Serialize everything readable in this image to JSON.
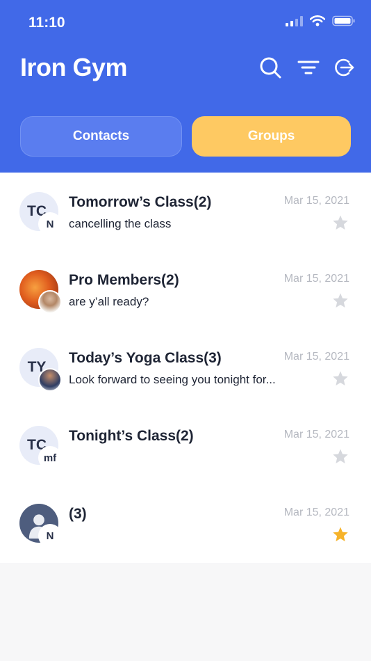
{
  "status_bar": {
    "time": "11:10"
  },
  "header": {
    "title": "Iron Gym",
    "icons": [
      "search-icon",
      "filter-icon",
      "logout-icon"
    ]
  },
  "tabs": [
    {
      "label": "Contacts",
      "active": false
    },
    {
      "label": "Groups",
      "active": true
    }
  ],
  "groups": [
    {
      "title": "Tomorrow’s Class(2)",
      "message": "cancelling the class",
      "date": "Mar 15, 2021",
      "initials": "TC",
      "sub_initials": "N",
      "starred": false
    },
    {
      "title": "Pro Members(2)",
      "message": "are y’all ready?",
      "date": "Mar 15, 2021",
      "initials": "",
      "sub_initials": "",
      "starred": false
    },
    {
      "title": "Today’s Yoga Class(3)",
      "message": "Look forward to seeing you tonight for...",
      "date": "Mar 15, 2021",
      "initials": "TY",
      "sub_initials": "",
      "starred": false
    },
    {
      "title": "Tonight’s Class(2)",
      "message": "",
      "date": "Mar 15, 2021",
      "initials": "TC",
      "sub_initials": "mf",
      "starred": false
    },
    {
      "title": "(3)",
      "message": "",
      "date": "Mar 15, 2021",
      "initials": "",
      "sub_initials": "N",
      "starred": true
    }
  ],
  "colors": {
    "primary": "#4169e8",
    "accent": "#fec962",
    "star_on": "#f6b32a",
    "star_off": "#d6d8dd"
  }
}
